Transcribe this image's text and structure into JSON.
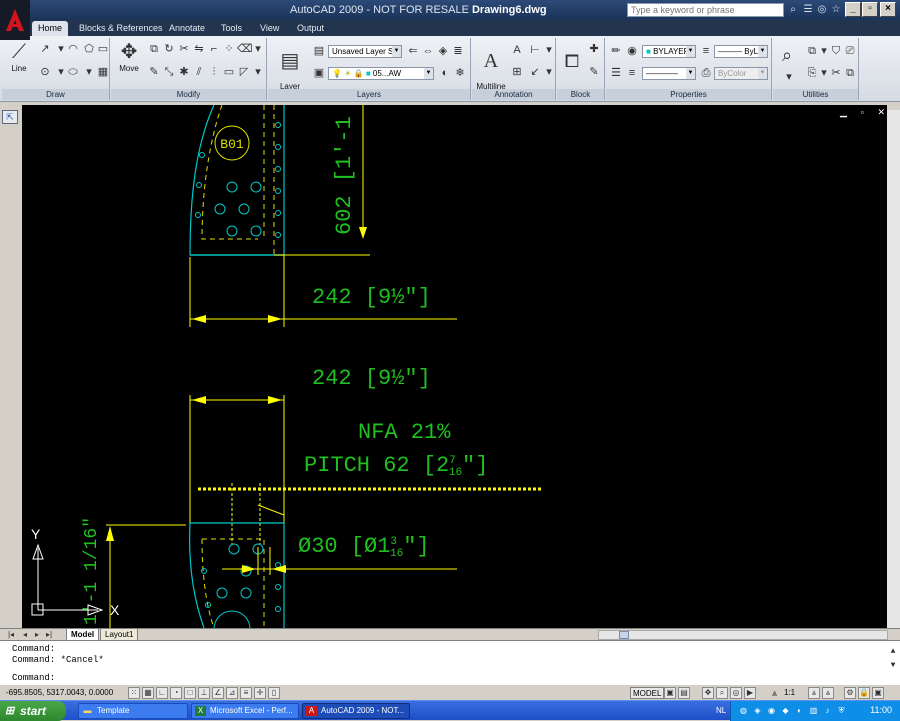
{
  "window": {
    "title_prefix": "AutoCAD 2009 - NOT FOR RESALE ",
    "title_doc": "Drawing6.dwg",
    "search_placeholder": "Type a keyword or phrase"
  },
  "ribbon_tabs": [
    "Home",
    "Blocks & References",
    "Annotate",
    "Tools",
    "View",
    "Output"
  ],
  "ribbon": {
    "draw": {
      "label": "Draw",
      "line_label": "Line"
    },
    "modify": {
      "label": "Modify",
      "move_label": "Move"
    },
    "layers": {
      "label": "Layers",
      "layer_props_label": "Layer\nProperties",
      "layer_state": "Unsaved Layer S",
      "current_layer": "05...AW"
    },
    "annotation": {
      "label": "Annotation",
      "mtext_label": "Multiline\nText"
    },
    "block": {
      "label": "Block"
    },
    "properties": {
      "label": "Properties",
      "color": "BYLAYER",
      "lineweight": "ByL",
      "plotstyle": "ByColor"
    },
    "utilities": {
      "label": "Utilities"
    }
  },
  "drawing": {
    "colors": {
      "dim": "#1fc01f",
      "dimline": "#ffff00",
      "part": "#00c8c8",
      "hidden": "#e0e000"
    },
    "dim_top_vertical": "602 [1'-1",
    "dim_242_a": "242 [9½\"]",
    "dim_242_b": "242 [9½\"]",
    "nfa": "NFA 21%",
    "pitch": "PITCH 62 [2 7/16\"]",
    "pitch_main": "PITCH 62 [2",
    "pitch_num": "7",
    "pitch_den": "16",
    "pitch_close": "\"]",
    "dia_main": "Ø30 [Ø1",
    "dia_num": "3",
    "dia_den": "16",
    "dia_close": "\"]",
    "dim_left_vertical": "1'-1 1/16\"",
    "balloon": "B01",
    "ucs_x": "X",
    "ucs_y": "Y"
  },
  "layout_tabs": [
    "Model",
    "Layout1"
  ],
  "command_lines": [
    "Command:",
    "Command: *Cancel*",
    "Command:"
  ],
  "status": {
    "coords": "-695.8505, 5317.0043, 0.0000",
    "model": "MODEL",
    "scale": "1:1"
  },
  "taskbar": {
    "start": "start",
    "tasks": [
      "Template",
      "Microsoft Excel - Perf...",
      "AutoCAD 2009 - NOT..."
    ],
    "lang": "NL",
    "clock": "11:00"
  }
}
